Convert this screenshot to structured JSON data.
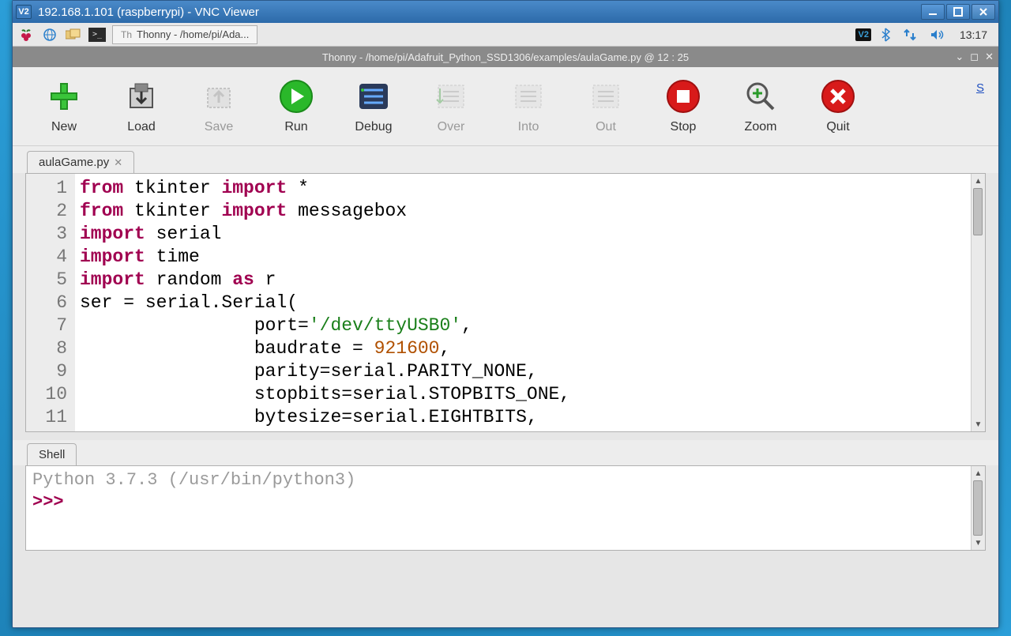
{
  "vnc": {
    "logo": "V2",
    "title": "192.168.1.101 (raspberrypi) - VNC Viewer"
  },
  "rpi_panel": {
    "task_label": "Thonny  -  /home/pi/Ada...",
    "tray_vnc": "V2",
    "clock": "13:17"
  },
  "thonny": {
    "title": "Thonny  -  /home/pi/Adafruit_Python_SSD1306/examples/aulaGame.py  @  12 : 25"
  },
  "toolbar": {
    "new": "New",
    "load": "Load",
    "save": "Save",
    "run": "Run",
    "debug": "Debug",
    "over": "Over",
    "into": "Into",
    "out": "Out",
    "stop": "Stop",
    "zoom": "Zoom",
    "quit": "Quit",
    "switch": "S"
  },
  "tab": {
    "filename": "aulaGame.py"
  },
  "gutter": [
    "1",
    "2",
    "3",
    "4",
    "5",
    "6",
    "7",
    "8",
    "9",
    "10",
    "11"
  ],
  "code": {
    "l1_a": "from",
    "l1_b": " tkinter ",
    "l1_c": "import",
    "l1_d": " *",
    "l2_a": "from",
    "l2_b": " tkinter ",
    "l2_c": "import",
    "l2_d": " messagebox",
    "l3_a": "import",
    "l3_b": " serial",
    "l4_a": "import",
    "l4_b": " time",
    "l5_a": "import",
    "l5_b": " random ",
    "l5_c": "as",
    "l5_d": " r",
    "l6": "ser = serial.Serial(",
    "l7_a": "                port=",
    "l7_b": "'/dev/ttyUSB0'",
    "l7_c": ",",
    "l8_a": "                baudrate = ",
    "l8_b": "921600",
    "l8_c": ",",
    "l9": "                parity=serial.PARITY_NONE,",
    "l10": "                stopbits=serial.STOPBITS_ONE,",
    "l11": "                bytesize=serial.EIGHTBITS,"
  },
  "shell": {
    "tab": "Shell",
    "version": "Python 3.7.3 (/usr/bin/python3)",
    "prompt": ">>> "
  }
}
